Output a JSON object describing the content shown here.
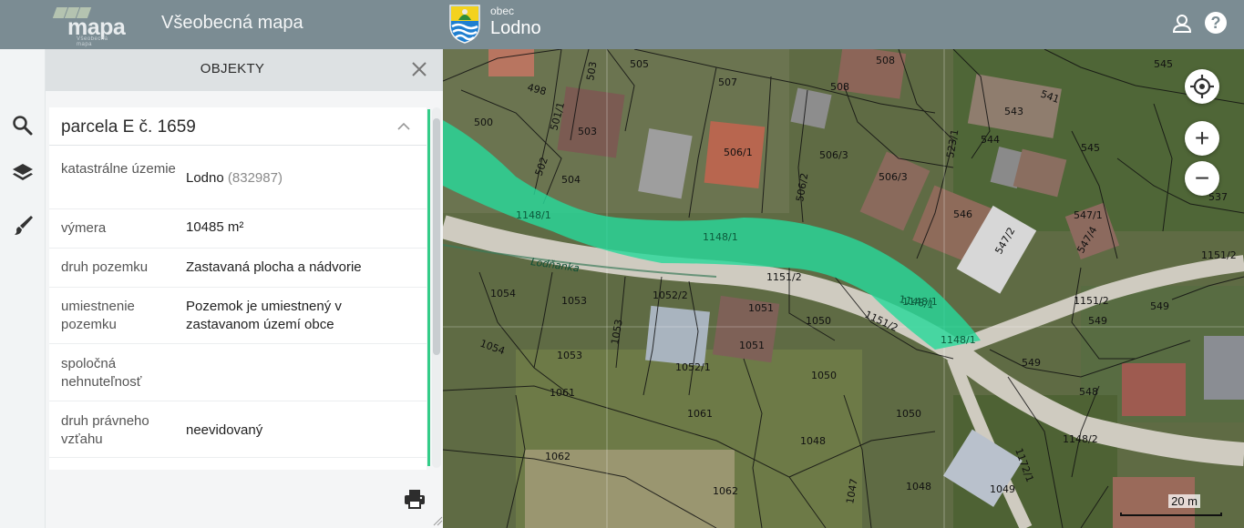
{
  "header": {
    "logo_text": "mapa",
    "logo_subtext": "Všeobecná mapa",
    "app_title": "Všeobecná mapa",
    "municipality_prefix": "obec",
    "municipality_name": "Lodno"
  },
  "panel": {
    "title": "OBJEKTY",
    "card_title": "parcela E č. 1659",
    "properties": [
      {
        "key": "katastrálne územie",
        "value": "Lodno",
        "code": "(832987)"
      },
      {
        "key": "výmera",
        "value": "10485 m²"
      },
      {
        "key": "druh pozemku",
        "value": "Zastavaná plocha a nádvorie"
      },
      {
        "key": "umiestnenie pozemku",
        "value": "Pozemok je umiestnený v zastavanom území obce"
      },
      {
        "key": "spoločná nehnuteľnosť",
        "value": ""
      },
      {
        "key": "druh právneho vzťahu",
        "value": "neevidovaný"
      }
    ]
  },
  "rail": {
    "icons": [
      "search-icon",
      "layers-icon",
      "brush-icon"
    ]
  },
  "map": {
    "scale_label": "20 m",
    "highlight_color": "#28d89a",
    "parcel_labels": [
      "505",
      "503",
      "508",
      "545",
      "541",
      "498",
      "507",
      "543",
      "500",
      "503",
      "506/1",
      "508",
      "544",
      "545",
      "501/1",
      "506/3",
      "523/1",
      "502",
      "504",
      "506/3",
      "506/2",
      "547/1",
      "546",
      "1148/1",
      "1148/1",
      "547/2",
      "547/4",
      "537",
      "1151/2",
      "1151/2",
      "1054",
      "1053",
      "1052/2",
      "1051",
      "1050",
      "1151/2",
      "1148/1",
      "549",
      "1151/2",
      "1053",
      "1051",
      "1052/1",
      "1050",
      "549",
      "548",
      "1054",
      "1053",
      "1061",
      "1061",
      "1050",
      "1148/2",
      "1048",
      "1062",
      "1062",
      "1049",
      "1047",
      "1048",
      "1172/1",
      "1148/1",
      "1148/1",
      "549"
    ],
    "stream_label": "Lodňanka"
  }
}
